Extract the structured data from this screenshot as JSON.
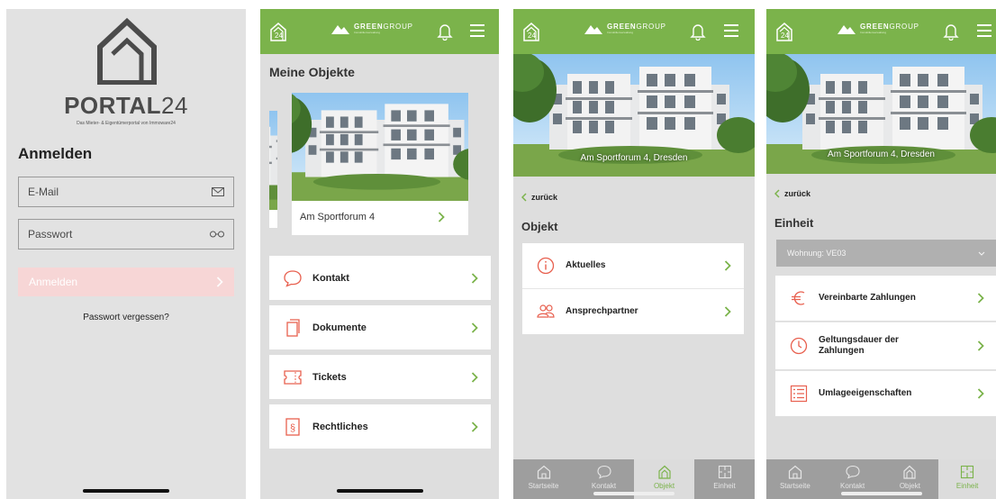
{
  "colors": {
    "accent_green": "#7bb34b",
    "accent_red": "#e8604f",
    "login_button": "#f7d6d6",
    "tabbar": "#9e9e9e"
  },
  "login": {
    "logo_text_bold": "PORTAL",
    "logo_text_num": "24",
    "logo_subtitle": "Das Mieter- & Eigentümerportal von Immoware24",
    "title": "Anmelden",
    "email_placeholder": "E-Mail",
    "password_placeholder": "Passwort",
    "submit_label": "Anmelden",
    "forgot_label": "Passwort vergessen?"
  },
  "header": {
    "app_badge": "24",
    "brand_green": "GREEN",
    "brand_group": "GROUP",
    "brand_sub": "Immobilienverwaltung"
  },
  "overview": {
    "title": "Meine Objekte",
    "property_label": "Am Sportforum 4",
    "menu": [
      {
        "label": "Kontakt",
        "icon": "chat-bubble-icon"
      },
      {
        "label": "Dokumente",
        "icon": "documents-icon"
      },
      {
        "label": "Tickets",
        "icon": "ticket-icon"
      },
      {
        "label": "Rechtliches",
        "icon": "paragraph-icon"
      }
    ]
  },
  "object": {
    "hero_caption": "Am Sportforum 4, Dresden",
    "back_label": "zurück",
    "title": "Objekt",
    "menu": [
      {
        "label": "Aktuelles",
        "icon": "info-icon"
      },
      {
        "label": "Ansprechpartner",
        "icon": "people-icon"
      }
    ]
  },
  "unit": {
    "hero_caption": "Am Sportforum 4, Dresden",
    "back_label": "zurück",
    "title": "Einheit",
    "select_value": "Wohnung: VE03",
    "menu": [
      {
        "label": "Vereinbarte Zahlungen",
        "icon": "euro-icon"
      },
      {
        "label": "Geltungsdauer der Zahlungen",
        "icon": "clock-icon"
      },
      {
        "label": "Umlageeigenschaften",
        "icon": "list-icon"
      }
    ]
  },
  "tabs": [
    {
      "label": "Startseite",
      "icon": "home-icon"
    },
    {
      "label": "Kontakt",
      "icon": "chat-bubble-icon"
    },
    {
      "label": "Objekt",
      "icon": "building-icon"
    },
    {
      "label": "Einheit",
      "icon": "floorplan-icon"
    }
  ],
  "active_tab_object_screen": "Objekt",
  "active_tab_unit_screen": "Einheit"
}
